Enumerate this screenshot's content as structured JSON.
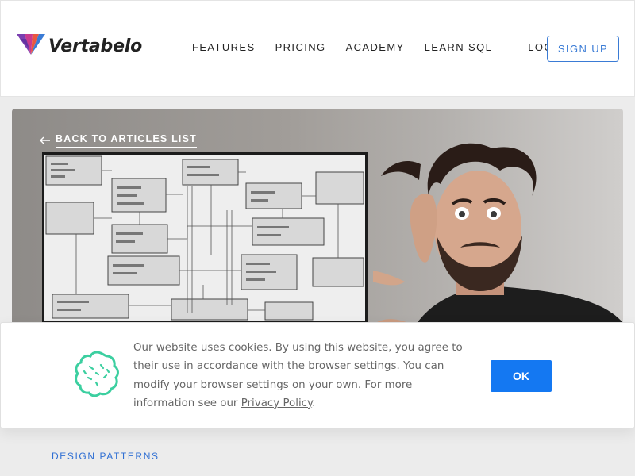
{
  "header": {
    "brand": "Vertabelo",
    "nav": [
      {
        "label": "FEATURES"
      },
      {
        "label": "PRICING"
      },
      {
        "label": "ACADEMY"
      },
      {
        "label": "LEARN SQL"
      }
    ],
    "login_label": "LOG IN",
    "signup_label": "SIGN UP"
  },
  "hero": {
    "back_label": "BACK TO ARTICLES LIST"
  },
  "cookie": {
    "text": "Our website uses cookies. By using this website, you agree to their use in accordance with the browser settings. You can modify your browser settings on your own. For more information see our ",
    "policy_link": "Privacy Policy",
    "text_end": ".",
    "ok_label": "OK"
  },
  "article": {
    "category": "DESIGN PATTERNS"
  },
  "colors": {
    "accent": "#1478f2",
    "link": "#3a7bd5",
    "cookie_icon": "#3ccfa0"
  }
}
